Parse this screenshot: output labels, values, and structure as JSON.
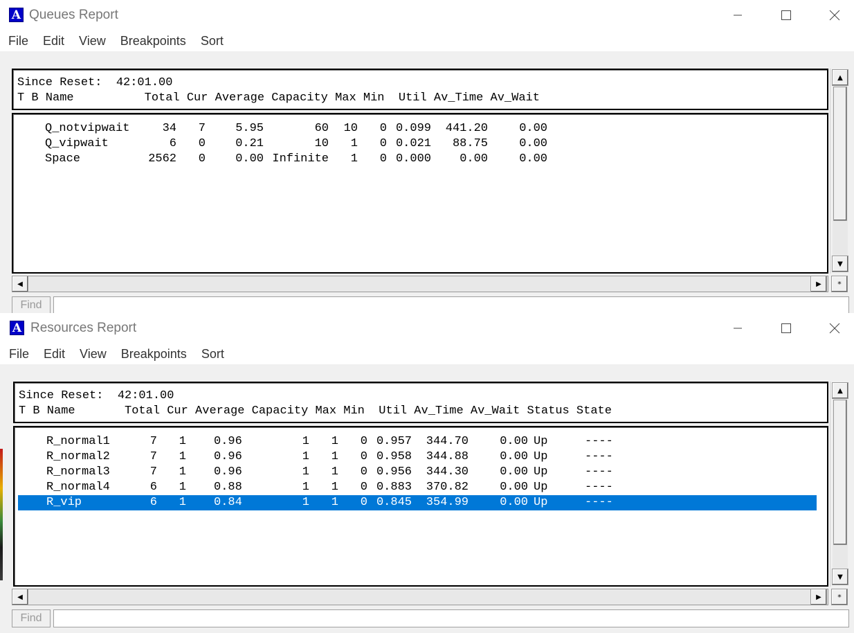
{
  "queues": {
    "title": "Queues Report",
    "menu": [
      "File",
      "Edit",
      "View",
      "Breakpoints",
      "Sort"
    ],
    "since_reset": "Since Reset:  42:01.00",
    "header": "T B Name          Total Cur Average Capacity Max Min  Util Av_Time Av_Wait",
    "rows": [
      {
        "name": "Q_notvipwait",
        "total": "34",
        "cur": "7",
        "average": "5.95",
        "capacity": "60",
        "max": "10",
        "min": "0",
        "util": "0.099",
        "av_time": "441.20",
        "av_wait": "0.00"
      },
      {
        "name": "Q_vipwait",
        "total": "6",
        "cur": "0",
        "average": "0.21",
        "capacity": "10",
        "max": "1",
        "min": "0",
        "util": "0.021",
        "av_time": "88.75",
        "av_wait": "0.00"
      },
      {
        "name": "Space",
        "total": "2562",
        "cur": "0",
        "average": "0.00",
        "capacity": "Infinite",
        "max": "1",
        "min": "0",
        "util": "0.000",
        "av_time": "0.00",
        "av_wait": "0.00"
      }
    ],
    "find_label": "Find",
    "find_value": ""
  },
  "resources": {
    "title": "Resources Report",
    "menu": [
      "File",
      "Edit",
      "View",
      "Breakpoints",
      "Sort"
    ],
    "since_reset": "Since Reset:  42:01.00",
    "header": "T B Name       Total Cur Average Capacity Max Min  Util Av_Time Av_Wait Status State",
    "rows": [
      {
        "name": "R_normal1",
        "total": "7",
        "cur": "1",
        "average": "0.96",
        "capacity": "1",
        "max": "1",
        "min": "0",
        "util": "0.957",
        "av_time": "344.70",
        "av_wait": "0.00",
        "status": "Up",
        "state": "----"
      },
      {
        "name": "R_normal2",
        "total": "7",
        "cur": "1",
        "average": "0.96",
        "capacity": "1",
        "max": "1",
        "min": "0",
        "util": "0.958",
        "av_time": "344.88",
        "av_wait": "0.00",
        "status": "Up",
        "state": "----"
      },
      {
        "name": "R_normal3",
        "total": "7",
        "cur": "1",
        "average": "0.96",
        "capacity": "1",
        "max": "1",
        "min": "0",
        "util": "0.956",
        "av_time": "344.30",
        "av_wait": "0.00",
        "status": "Up",
        "state": "----"
      },
      {
        "name": "R_normal4",
        "total": "6",
        "cur": "1",
        "average": "0.88",
        "capacity": "1",
        "max": "1",
        "min": "0",
        "util": "0.883",
        "av_time": "370.82",
        "av_wait": "0.00",
        "status": "Up",
        "state": "----"
      },
      {
        "name": "R_vip",
        "total": "6",
        "cur": "1",
        "average": "0.84",
        "capacity": "1",
        "max": "1",
        "min": "0",
        "util": "0.845",
        "av_time": "354.99",
        "av_wait": "0.00",
        "status": "Up",
        "state": "----",
        "selected": true
      }
    ],
    "find_label": "Find",
    "find_value": ""
  },
  "icons": {
    "app": "app-a-icon",
    "minimize": "minimize-icon",
    "maximize": "maximize-icon",
    "close": "close-icon",
    "scroll_up": "scroll-up-arrow-icon",
    "scroll_down": "scroll-down-arrow-icon",
    "scroll_left": "scroll-left-arrow-icon",
    "scroll_right": "scroll-right-arrow-icon",
    "star": "star-icon"
  },
  "colors": {
    "selection": "#0078d7",
    "app_icon": "#0000c8"
  }
}
